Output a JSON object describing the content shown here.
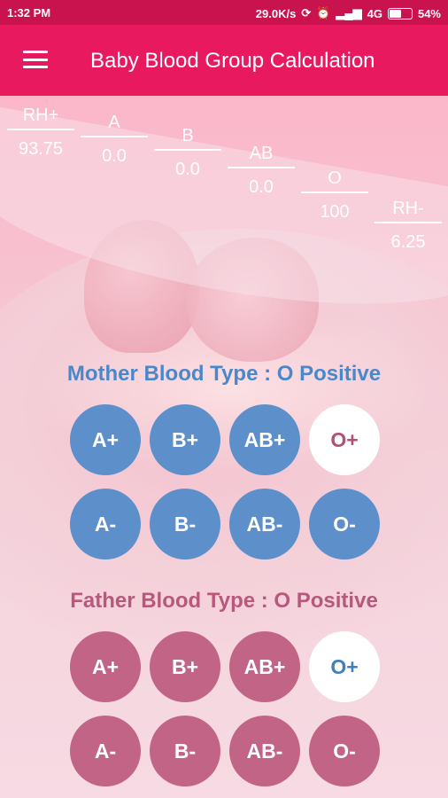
{
  "status": {
    "time": "1:32 PM",
    "speed": "29.0K/s",
    "network": "4G",
    "battery": "54%"
  },
  "app": {
    "title": "Baby Blood Group Calculation"
  },
  "results": [
    {
      "label": "RH+",
      "value": "93.75"
    },
    {
      "label": "A",
      "value": "0.0"
    },
    {
      "label": "B",
      "value": "0.0"
    },
    {
      "label": "AB",
      "value": "0.0"
    },
    {
      "label": "O",
      "value": "100"
    },
    {
      "label": "RH-",
      "value": "6.25"
    }
  ],
  "mother": {
    "title": "Mother Blood Type : O Positive",
    "types": [
      "A+",
      "B+",
      "AB+",
      "O+",
      "A-",
      "B-",
      "AB-",
      "O-"
    ],
    "selected": "O+",
    "color": "#5d8fcb"
  },
  "father": {
    "title": "Father Blood Type : O Positive",
    "types": [
      "A+",
      "B+",
      "AB+",
      "O+",
      "A-",
      "B-",
      "AB-",
      "O-"
    ],
    "selected": "O+",
    "color": "#c26485"
  },
  "colors": {
    "appbar": "#e8195f",
    "statusbar": "#c9134f"
  }
}
